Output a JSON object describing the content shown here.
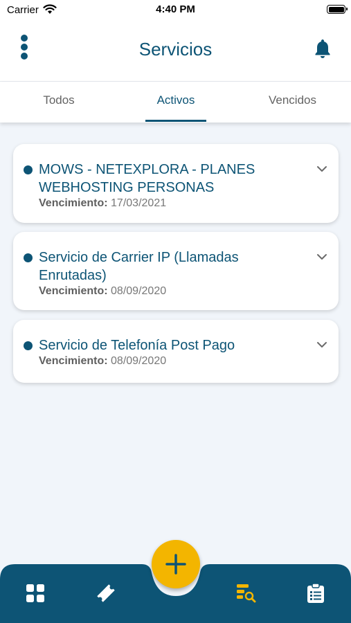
{
  "status_bar": {
    "carrier": "Carrier",
    "time": "4:40 PM"
  },
  "header": {
    "title": "Servicios"
  },
  "tabs": [
    {
      "label": "Todos",
      "active": false
    },
    {
      "label": "Activos",
      "active": true
    },
    {
      "label": "Vencidos",
      "active": false
    }
  ],
  "services": [
    {
      "title": "MOWS - NETEXPLORA - PLANES WEBHOSTING PERSONAS",
      "expiry_label": "Vencimiento:",
      "expiry_date": "17/03/2021"
    },
    {
      "title": "Servicio de Carrier IP (Llamadas Enrutadas)",
      "expiry_label": "Vencimiento:",
      "expiry_date": "08/09/2020"
    },
    {
      "title": "Servicio de Telefonía Post Pago",
      "expiry_label": "Vencimiento:",
      "expiry_date": "08/09/2020"
    }
  ],
  "bottom_nav": {
    "items": [
      {
        "icon": "dashboard-grid-icon",
        "active": false
      },
      {
        "icon": "ticket-icon",
        "active": false
      },
      {
        "icon": "services-search-icon",
        "active": true
      },
      {
        "icon": "clipboard-icon",
        "active": false
      }
    ],
    "fab_icon": "plus-icon"
  },
  "colors": {
    "primary": "#0d5475",
    "accent": "#f3b500",
    "background": "#f1f5fa",
    "card": "#ffffff"
  }
}
